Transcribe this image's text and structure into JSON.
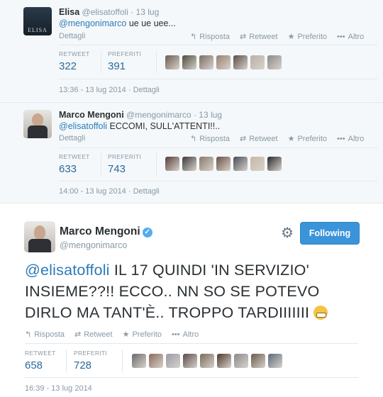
{
  "tweets": [
    {
      "avatar_label": "ELISA",
      "name": "Elisa",
      "handle": "@elisatoffoli",
      "sep": "·",
      "date": "13 lug",
      "mention": "@mengonimarco",
      "text": " ue ue uee...",
      "details": "Dettagli",
      "actions": [
        "Risposta",
        "Retweet",
        "Preferito",
        "Altro"
      ],
      "retweet_label": "RETWEET",
      "retweet_count": "322",
      "fav_label": "PREFERITI",
      "fav_count": "391",
      "timestamp": "13:36 - 13 lug 2014 · Dettagli"
    },
    {
      "name": "Marco Mengoni",
      "handle": "@mengonimarco",
      "sep": "·",
      "date": "13 lug",
      "mention": "@elisatoffoli",
      "text": " ECCOMI, SULL'ATTENTI!!..",
      "details": "Dettagli",
      "actions": [
        "Risposta",
        "Retweet",
        "Preferito",
        "Altro"
      ],
      "retweet_label": "RETWEET",
      "retweet_count": "633",
      "fav_label": "PREFERITI",
      "fav_count": "743",
      "timestamp": "14:00 - 13 lug 2014 · Dettagli"
    }
  ],
  "main": {
    "name": "Marco Mengoni",
    "handle": "@mengonimarco",
    "follow_label": "Following",
    "mention": "@elisatoffoli",
    "text": " IL 17 QUINDI 'IN SERVIZIO' INSIEME??!! ECCO.. NN SO SE POTEVO DIRLO MA TANT'È.. TROPPO TARDIIIIIII ",
    "actions": [
      "Risposta",
      "Retweet",
      "Preferito",
      "Altro"
    ],
    "retweet_label": "RETWEET",
    "retweet_count": "658",
    "fav_label": "PREFERITI",
    "fav_count": "728",
    "timestamp": "16:39 - 13 lug 2014"
  },
  "icons": {
    "reply": "reply-icon",
    "retweet": "retweet-icon",
    "favorite": "star-icon",
    "more": "more-icon",
    "gear": "gear-icon",
    "verified": "verified-badge-icon",
    "emoji": "grimacing-face-emoji"
  },
  "colors": {
    "link": "#2b7bb9",
    "follow_button": "#3b94d9",
    "muted": "#8899a6",
    "context_bg": "#f5f8fa"
  },
  "faces_colors": {
    "t1": [
      "#6b5a4e",
      "#4a4a3a",
      "#7c6d63",
      "#9a7f6f",
      "#5a4b45",
      "#b8b0a8",
      "#8a8a8a"
    ],
    "t2": [
      "#5a3a3a",
      "#3a3a3a",
      "#8a7a6a",
      "#6a5040",
      "#4a4a55",
      "#c8b8a8",
      "#2a2a2a"
    ],
    "t3": [
      "#6a6a6a",
      "#8a6a5a",
      "#9a9aaa",
      "#5a4a4a",
      "#7a6a5a",
      "#4a3a2a",
      "#8a8a8a",
      "#6a5a4a",
      "#5a6a7a"
    ]
  }
}
